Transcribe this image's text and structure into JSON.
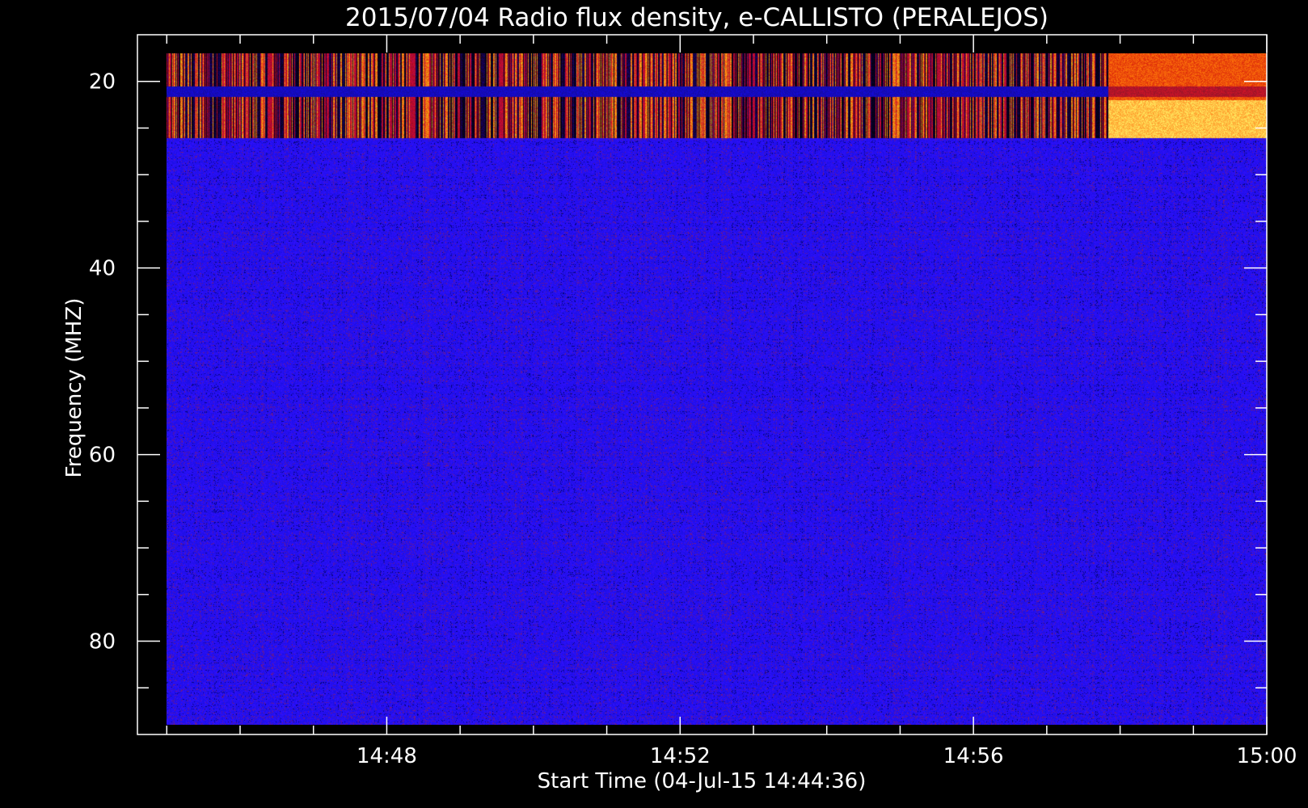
{
  "chart_data": {
    "type": "heatmap",
    "title": "2015/07/04  Radio flux density, e-CALLISTO (PERALEJOS)",
    "xlabel": "Start Time (04-Jul-15 14:44:36)",
    "ylabel": "Frequency (MHZ)",
    "xlim": [
      "14:44:36",
      "15:00:00"
    ],
    "ylim": [
      90,
      15
    ],
    "data_extent": {
      "time_start": "14:45:00",
      "time_end": "15:00:00",
      "freq_top": 17,
      "freq_bottom": 89
    },
    "x_ticks_major": [
      "14:48",
      "14:52",
      "14:56",
      "15:00"
    ],
    "x_ticks_minor": [
      "14:45",
      "14:46",
      "14:47",
      "14:49",
      "14:50",
      "14:51",
      "14:53",
      "14:54",
      "14:55",
      "14:57",
      "14:58",
      "14:59"
    ],
    "y_ticks_major": [
      20,
      40,
      60,
      80
    ],
    "y_ticks_minor": [
      25,
      30,
      35,
      45,
      50,
      55,
      65,
      70,
      75,
      85
    ],
    "colormap": [
      "#000000",
      "#0000ff",
      "#7a2070",
      "#c01010",
      "#ff4000",
      "#ffa040",
      "#ffe080"
    ],
    "background_color": "#1a14f0",
    "features": [
      {
        "kind": "interference_band",
        "freq_range": [
          17,
          26
        ],
        "time_range": [
          "14:45:00",
          "14:57:50"
        ],
        "intensity": "high, striped"
      },
      {
        "kind": "burst",
        "freq_range": [
          17,
          26
        ],
        "time_range": [
          "14:57:50",
          "15:00:00"
        ],
        "intensity": "very high"
      }
    ]
  }
}
